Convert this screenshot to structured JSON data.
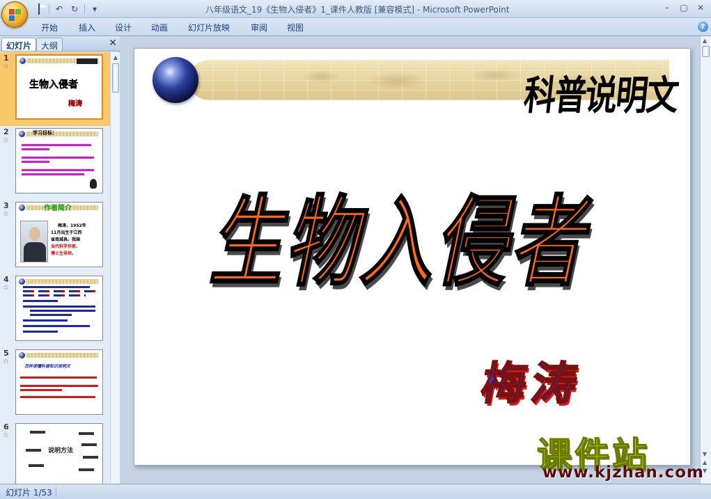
{
  "window": {
    "title": "八年级语文_19《生物入侵者》1_课件人教版 [兼容模式] - Microsoft PowerPoint",
    "controls": [
      "–",
      "▢",
      "✕"
    ]
  },
  "quick_access": {
    "undo": "↶",
    "redo": "↻",
    "customize": "▾"
  },
  "ribbon": {
    "tabs": [
      "开始",
      "插入",
      "设计",
      "动画",
      "幻灯片放映",
      "审阅",
      "视图"
    ],
    "help": "?"
  },
  "left_pane": {
    "tabs": [
      "幻灯片",
      "大纲"
    ],
    "close": "✕",
    "slides": [
      {
        "num": "1",
        "lines": [
          "生物入侵者",
          "梅涛"
        ]
      },
      {
        "num": "2",
        "lines": [
          "学习目标："
        ]
      },
      {
        "num": "3",
        "lines": [
          "作者简介",
          "梅涛，1952年",
          "11月出生于江西",
          "省南城县。我国",
          "当代科学作家、",
          "博士生导师。"
        ]
      },
      {
        "num": "4",
        "lines": []
      },
      {
        "num": "5",
        "lines": [
          "怎样读懂科普知识说明文"
        ]
      },
      {
        "num": "6",
        "lines": [
          "说明方法"
        ]
      }
    ]
  },
  "slide": {
    "genre": "科普说明文",
    "title": "生物入侵者",
    "author": "梅涛"
  },
  "watermark": {
    "cn": "课件站",
    "url": "www.kjzhan.com"
  },
  "status": {
    "slide_indicator": "幻灯片 1/53"
  },
  "colors": {
    "title_orange": "#ff6a14",
    "author_blue": "#1f3fd8",
    "selection": "#f9c86a",
    "ribbon_text": "#15428b"
  }
}
